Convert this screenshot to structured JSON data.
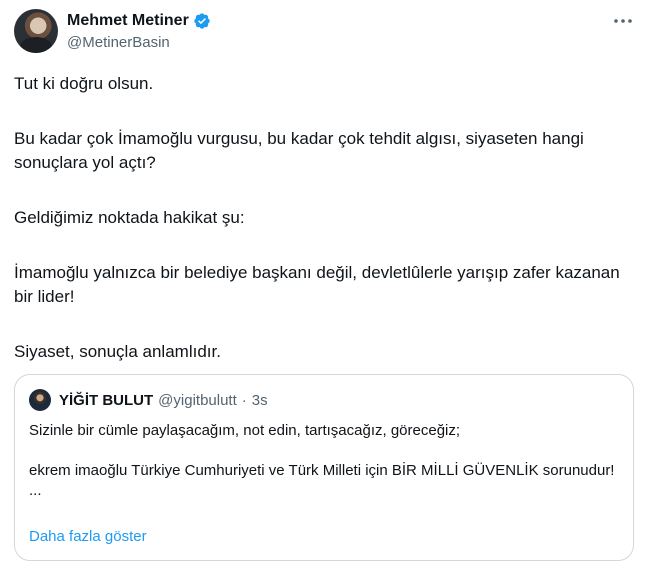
{
  "tweet": {
    "author": {
      "display_name": "Mehmet Metiner",
      "handle": "@MetinerBasin",
      "verified_icon": "verified-badge-icon",
      "avatar_icon": "avatar"
    },
    "more_icon": "more-options-icon",
    "paragraphs": [
      "Tut ki doğru olsun.",
      "Bu kadar çok İmamoğlu vurgusu, bu kadar çok tehdit algısı, siyaseten hangi sonuçlara yol açtı?",
      "Geldiğimiz noktada hakikat şu:",
      "İmamoğlu yalnızca bir belediye başkanı değil, devletlûlerle yarışıp zafer kazanan bir lider!",
      "Siyaset, sonuçla anlamlıdır."
    ]
  },
  "quoted": {
    "display_name": "YİĞİT BULUT",
    "handle": "@yigitbulutt",
    "separator": "·",
    "time": "3s",
    "lines": [
      "Sizinle bir cümle paylaşacağım, not edin, tartışacağız, göreceğiz;",
      "ekrem imaoğlu Türkiye Cumhuriyeti ve Türk Milleti için BİR MİLLİ GÜVENLİK sorunudur!",
      "..."
    ],
    "show_more": "Daha fazla göster"
  },
  "colors": {
    "text": "#0f1419",
    "secondary": "#536471",
    "link": "#1d9bf0",
    "border": "#cfd9de",
    "verified": "#1d9bf0"
  }
}
